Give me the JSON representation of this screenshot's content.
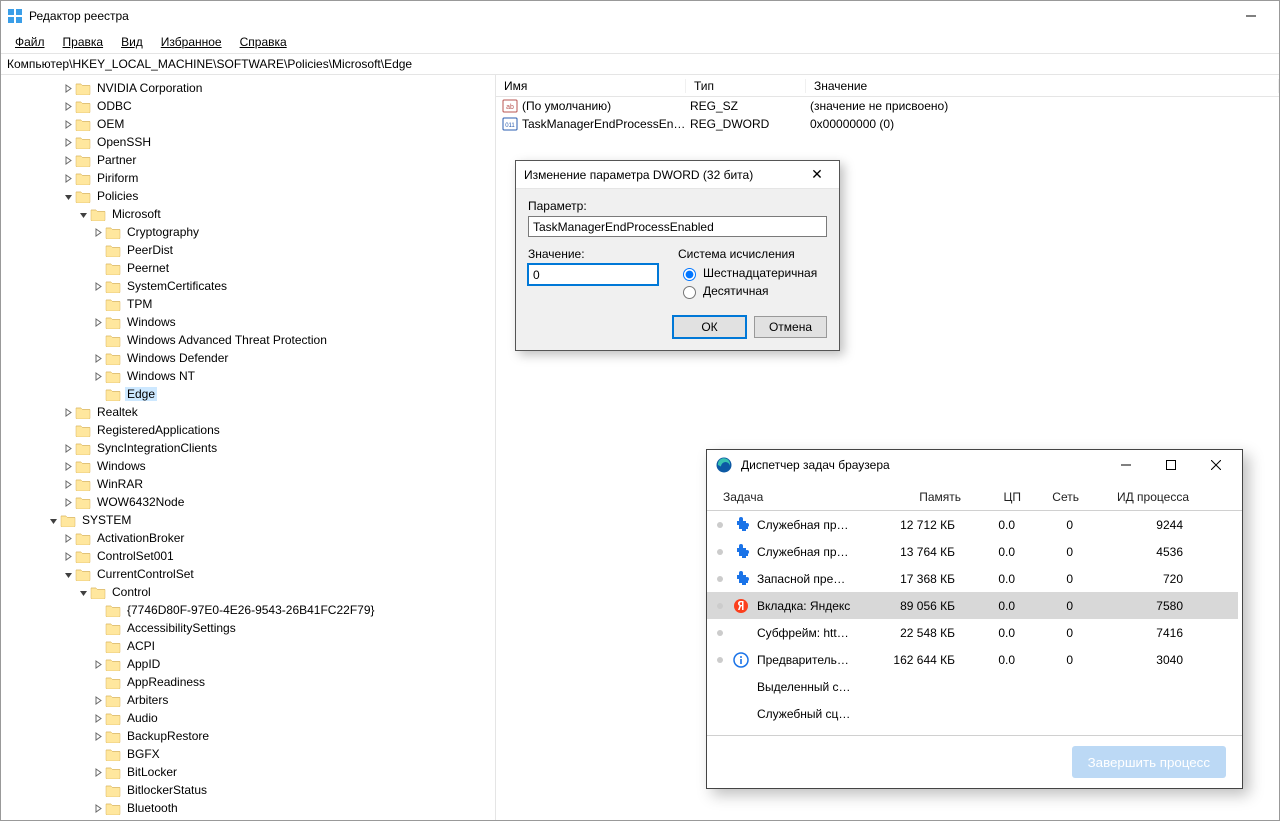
{
  "regedit": {
    "title": "Редактор реестра",
    "menu": {
      "file": "Файл",
      "edit": "Правка",
      "view": "Вид",
      "favorites": "Избранное",
      "help": "Справка"
    },
    "path": "Компьютер\\HKEY_LOCAL_MACHINE\\SOFTWARE\\Policies\\Microsoft\\Edge",
    "tree": [
      {
        "label": "NVIDIA Corporation",
        "depth": 4,
        "arrow": "closed"
      },
      {
        "label": "ODBC",
        "depth": 4,
        "arrow": "closed"
      },
      {
        "label": "OEM",
        "depth": 4,
        "arrow": "closed"
      },
      {
        "label": "OpenSSH",
        "depth": 4,
        "arrow": "closed"
      },
      {
        "label": "Partner",
        "depth": 4,
        "arrow": "closed"
      },
      {
        "label": "Piriform",
        "depth": 4,
        "arrow": "closed"
      },
      {
        "label": "Policies",
        "depth": 4,
        "arrow": "open"
      },
      {
        "label": "Microsoft",
        "depth": 5,
        "arrow": "open"
      },
      {
        "label": "Cryptography",
        "depth": 6,
        "arrow": "closed"
      },
      {
        "label": "PeerDist",
        "depth": 6,
        "arrow": "none"
      },
      {
        "label": "Peernet",
        "depth": 6,
        "arrow": "none"
      },
      {
        "label": "SystemCertificates",
        "depth": 6,
        "arrow": "closed"
      },
      {
        "label": "TPM",
        "depth": 6,
        "arrow": "none"
      },
      {
        "label": "Windows",
        "depth": 6,
        "arrow": "closed"
      },
      {
        "label": "Windows Advanced Threat Protection",
        "depth": 6,
        "arrow": "none"
      },
      {
        "label": "Windows Defender",
        "depth": 6,
        "arrow": "closed"
      },
      {
        "label": "Windows NT",
        "depth": 6,
        "arrow": "closed"
      },
      {
        "label": "Edge",
        "depth": 6,
        "arrow": "none",
        "selected": true
      },
      {
        "label": "Realtek",
        "depth": 4,
        "arrow": "closed"
      },
      {
        "label": "RegisteredApplications",
        "depth": 4,
        "arrow": "none"
      },
      {
        "label": "SyncIntegrationClients",
        "depth": 4,
        "arrow": "closed"
      },
      {
        "label": "Windows",
        "depth": 4,
        "arrow": "closed"
      },
      {
        "label": "WinRAR",
        "depth": 4,
        "arrow": "closed"
      },
      {
        "label": "WOW6432Node",
        "depth": 4,
        "arrow": "closed"
      },
      {
        "label": "SYSTEM",
        "depth": 3,
        "arrow": "open"
      },
      {
        "label": "ActivationBroker",
        "depth": 4,
        "arrow": "closed"
      },
      {
        "label": "ControlSet001",
        "depth": 4,
        "arrow": "closed"
      },
      {
        "label": "CurrentControlSet",
        "depth": 4,
        "arrow": "open"
      },
      {
        "label": "Control",
        "depth": 5,
        "arrow": "open"
      },
      {
        "label": "{7746D80F-97E0-4E26-9543-26B41FC22F79}",
        "depth": 6,
        "arrow": "none"
      },
      {
        "label": "AccessibilitySettings",
        "depth": 6,
        "arrow": "none"
      },
      {
        "label": "ACPI",
        "depth": 6,
        "arrow": "none"
      },
      {
        "label": "AppID",
        "depth": 6,
        "arrow": "closed"
      },
      {
        "label": "AppReadiness",
        "depth": 6,
        "arrow": "none"
      },
      {
        "label": "Arbiters",
        "depth": 6,
        "arrow": "closed"
      },
      {
        "label": "Audio",
        "depth": 6,
        "arrow": "closed"
      },
      {
        "label": "BackupRestore",
        "depth": 6,
        "arrow": "closed"
      },
      {
        "label": "BGFX",
        "depth": 6,
        "arrow": "none"
      },
      {
        "label": "BitLocker",
        "depth": 6,
        "arrow": "closed"
      },
      {
        "label": "BitlockerStatus",
        "depth": 6,
        "arrow": "none"
      },
      {
        "label": "Bluetooth",
        "depth": 6,
        "arrow": "closed"
      }
    ],
    "valueCols": {
      "name": "Имя",
      "type": "Тип",
      "data": "Значение"
    },
    "values": [
      {
        "icon": "sz",
        "name": "(По умолчанию)",
        "type": "REG_SZ",
        "data": "(значение не присвоено)"
      },
      {
        "icon": "dw",
        "name": "TaskManagerEndProcessEnabled",
        "type": "REG_DWORD",
        "data": "0x00000000 (0)"
      }
    ]
  },
  "dlg": {
    "title": "Изменение параметра DWORD (32 бита)",
    "paramLabel": "Параметр:",
    "paramValue": "TaskManagerEndProcessEnabled",
    "valueLabel": "Значение:",
    "valueValue": "0",
    "baseLabel": "Система исчисления",
    "hex": "Шестнадцатеричная",
    "dec": "Десятичная",
    "ok": "ОК",
    "cancel": "Отмена"
  },
  "btm": {
    "title": "Диспетчер задач браузера",
    "cols": {
      "task": "Задача",
      "mem": "Память",
      "cpu": "ЦП",
      "net": "Сеть",
      "pid": "ИД процесса"
    },
    "rows": [
      {
        "icon": "ext",
        "task": "Служебная пр…",
        "mem": "12 712 КБ",
        "cpu": "0.0",
        "net": "0",
        "pid": "9244"
      },
      {
        "icon": "ext",
        "task": "Служебная пр…",
        "mem": "13 764 КБ",
        "cpu": "0.0",
        "net": "0",
        "pid": "4536"
      },
      {
        "icon": "ext",
        "task": "Запасной пре…",
        "mem": "17 368 КБ",
        "cpu": "0.0",
        "net": "0",
        "pid": "720"
      },
      {
        "icon": "yandex",
        "task": "Вкладка: Яндекс",
        "mem": "89 056 КБ",
        "cpu": "0.0",
        "net": "0",
        "pid": "7580",
        "selected": true
      },
      {
        "icon": "none",
        "task": "Субфрейм: htt…",
        "mem": "22 548 КБ",
        "cpu": "0.0",
        "net": "0",
        "pid": "7416"
      },
      {
        "icon": "info",
        "task": "Предваритель…",
        "mem": "162 644 КБ",
        "cpu": "0.0",
        "net": "0",
        "pid": "3040"
      },
      {
        "icon": "none",
        "task": "Выделенный с…",
        "sub": true
      },
      {
        "icon": "none",
        "task": "Служебный сц…",
        "sub": true
      }
    ],
    "endBtn": "Завершить процесс"
  }
}
